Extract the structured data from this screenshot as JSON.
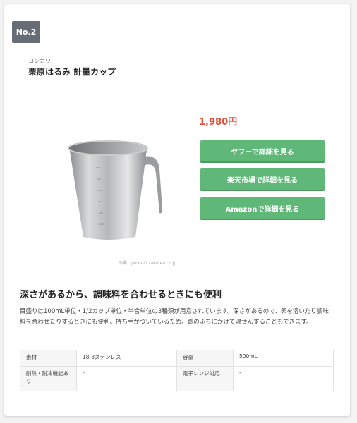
{
  "rank": "No.2",
  "brand": "ヨシカワ",
  "title": "栗原はるみ 計量カップ",
  "price": "1,980円",
  "buttons": {
    "yahoo": "ヤフーで詳細を見る",
    "rakuten": "楽天市場で詳細を見る",
    "amazon": "Amazonで詳細を見る"
  },
  "image_credit": "出典：product.rakuten.co.jp",
  "headline": "深さがあるから、調味料を合わせるときにも便利",
  "description": "目盛りは100mL単位・1/2カップ単位・半合単位の3種類が用意されています。深さがあるので、卵を溶いたり調味料を合わせたりするときにも便利。持ち手がついているため、鍋のふちにかけて湯せんすることもできます。",
  "specs": {
    "material_label": "素材",
    "material_value": "18-8ステンレス",
    "capacity_label": "容量",
    "capacity_value": "500mL",
    "heat_label": "耐熱・耐冷機能あり",
    "heat_value": "-",
    "microwave_label": "電子レンジ対応",
    "microwave_value": "-"
  },
  "colors": {
    "button": "#5fb878",
    "price": "#e0503a",
    "rank_badge": "#666d74"
  }
}
